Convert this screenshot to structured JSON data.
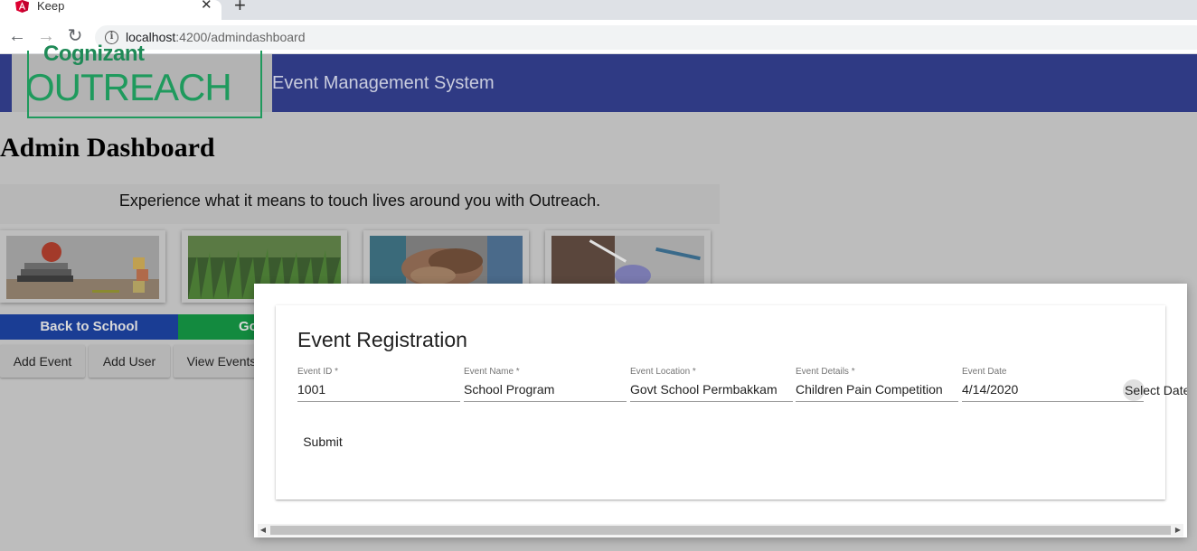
{
  "browser": {
    "tab_title": "Keep",
    "tab_close": "✕",
    "new_tab": "+",
    "url_host": "localhost",
    "url_path": ":4200/admindashboard",
    "back": "←",
    "forward": "→",
    "reload": "↻"
  },
  "header": {
    "logo_top": "Cognizant",
    "logo_main": "OUTREACH",
    "app_title": "Event Management System",
    "bar_color": "#2f3a84"
  },
  "dashboard": {
    "title": "Admin Dashboard",
    "tagline": "Experience what it means to touch lives around you with Outreach.",
    "ribbons": [
      {
        "label": "Back to School",
        "color": "#1a3d94"
      },
      {
        "label": "Go",
        "color": "#138a3f"
      }
    ],
    "actions": [
      "Add Event",
      "Add User",
      "View Events"
    ]
  },
  "dialog": {
    "title": "Event Registration",
    "fields": [
      {
        "label": "Event ID *",
        "value": "1001"
      },
      {
        "label": "Event Name *",
        "value": "School Program"
      },
      {
        "label": "Event Location *",
        "value": "Govt School Permbakkam"
      },
      {
        "label": "Event Details *",
        "value": "Children Pain Competition"
      },
      {
        "label": "Event Date",
        "value": "4/14/2020"
      }
    ],
    "select_date": "Select Date",
    "submit": "Submit"
  }
}
